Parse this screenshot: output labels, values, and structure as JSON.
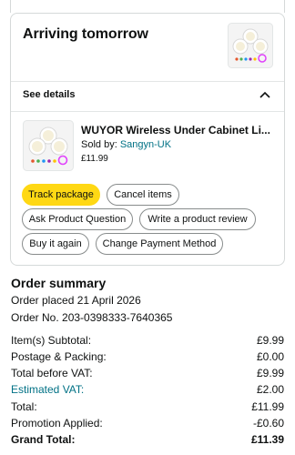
{
  "delivery": {
    "heading": "Arriving tomorrow",
    "see_details": "See details"
  },
  "item": {
    "title": "WUYOR Wireless Under Cabinet Li...",
    "sold_by_label": "Sold by: ",
    "seller": "Sangyn-UK",
    "price": "£11.99"
  },
  "actions": {
    "track_package": "Track package",
    "cancel_items": "Cancel items",
    "ask_question": "Ask Product Question",
    "write_review": "Write a product review",
    "buy_again": "Buy it again",
    "change_payment": "Change Payment Method"
  },
  "summary": {
    "heading": "Order summary",
    "order_placed": "Order placed 21 April 2026",
    "order_no": "Order No. 203-0398333-7640365",
    "rows": [
      {
        "label": "Item(s) Subtotal:",
        "value": "£9.99"
      },
      {
        "label": "Postage & Packing:",
        "value": "£0.00"
      },
      {
        "label": "Total before VAT:",
        "value": "£9.99"
      },
      {
        "label": "Estimated VAT:",
        "value": "£2.00"
      },
      {
        "label": "Total:",
        "value": "£11.99"
      },
      {
        "label": "Promotion Applied:",
        "value": "-£0.60"
      },
      {
        "label": "Grand Total:",
        "value": "£11.39"
      }
    ]
  },
  "colors": {
    "accent_link": "#007185",
    "primary_button": "#ffd814",
    "border": "#d5d9d9"
  },
  "icons": [
    "product-thumbnail-icon",
    "chevron-up-icon"
  ]
}
